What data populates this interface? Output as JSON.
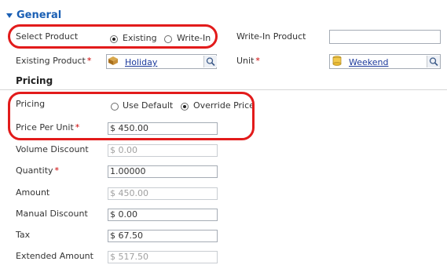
{
  "general": {
    "title": "General"
  },
  "select_product": {
    "label": "Select Product",
    "options": [
      "Existing",
      "Write-In"
    ],
    "selected": "Existing"
  },
  "write_in_product": {
    "label": "Write-In Product",
    "value": ""
  },
  "existing_product": {
    "label": "Existing Product",
    "value": "Holiday"
  },
  "unit": {
    "label": "Unit",
    "value": "Weekend"
  },
  "pricing_section": {
    "title": "Pricing"
  },
  "pricing": {
    "label": "Pricing",
    "options": [
      "Use Default",
      "Override Price"
    ],
    "selected": "Override Price"
  },
  "price_per_unit": {
    "label": "Price Per Unit",
    "value": "$ 450.00"
  },
  "volume_discount": {
    "label": "Volume Discount",
    "value": "$ 0.00"
  },
  "quantity": {
    "label": "Quantity",
    "value": "1.00000"
  },
  "amount": {
    "label": "Amount",
    "value": "$ 450.00"
  },
  "manual_discount": {
    "label": "Manual Discount",
    "value": "$ 0.00"
  },
  "tax": {
    "label": "Tax",
    "value": "$ 67.50"
  },
  "extended_amount": {
    "label": "Extended Amount",
    "value": "$ 517.50"
  },
  "required_marker": "*",
  "colors": {
    "section_blue": "#1a5fb4",
    "highlight_red": "#e21b1b",
    "required_red": "#cc0000"
  }
}
